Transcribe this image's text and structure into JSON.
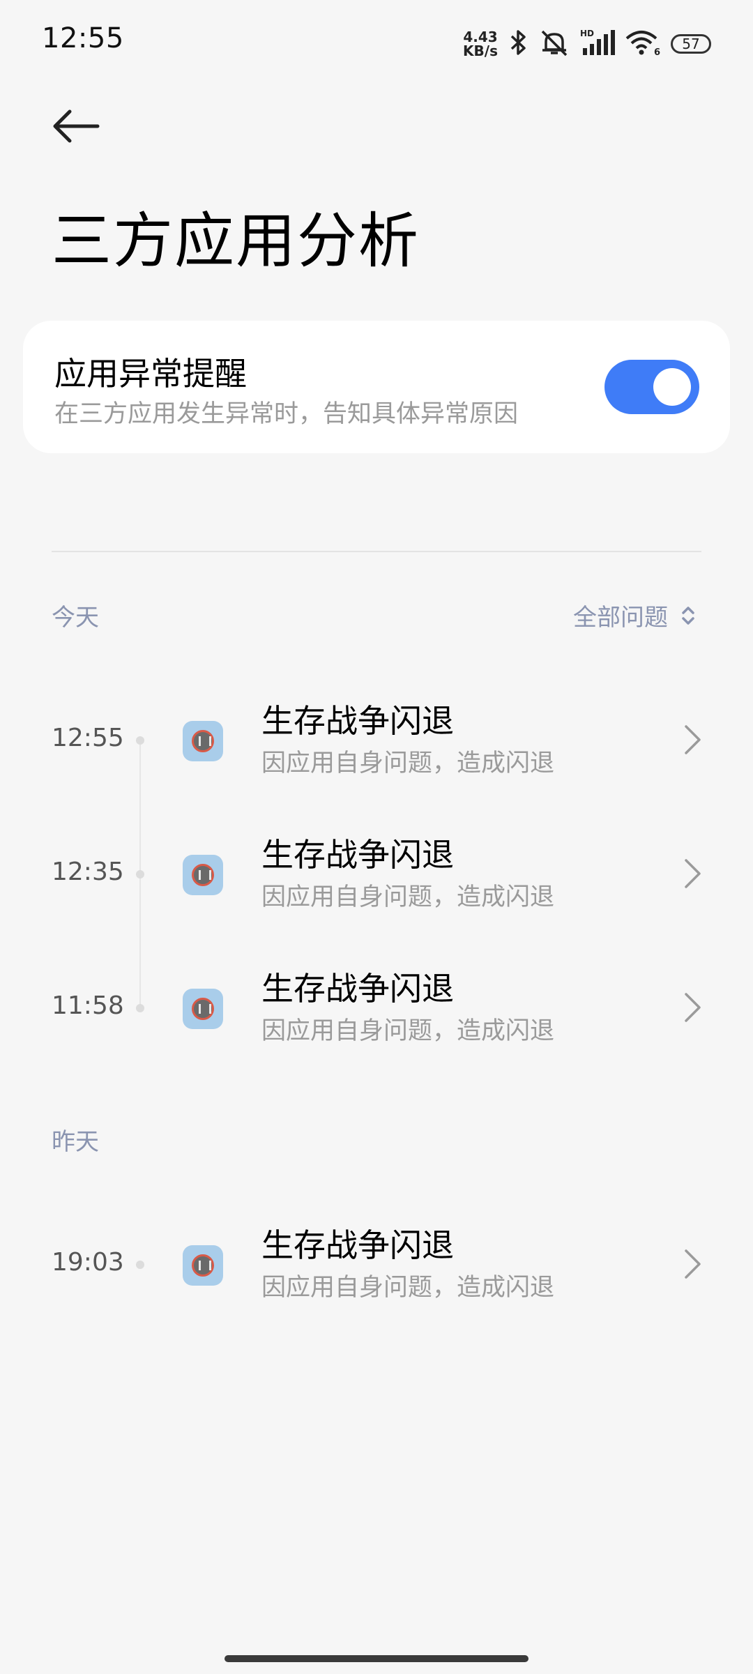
{
  "status_bar": {
    "time": "12:55",
    "net_speed_value": "4.43",
    "net_speed_unit": "KB/s",
    "signal_label": "HD",
    "wifi_label": "6",
    "battery": "57"
  },
  "header": {
    "title": "三方应用分析"
  },
  "settings_card": {
    "title": "应用异常提醒",
    "subtitle": "在三方应用发生异常时，告知具体异常原因",
    "toggle_on": true
  },
  "sections": {
    "today_label": "今天",
    "filter_label": "全部问题",
    "yesterday_label": "昨天"
  },
  "today_items": [
    {
      "time": "12:55",
      "title": "生存战争闪退",
      "subtitle": "因应用自身问题，造成闪退"
    },
    {
      "time": "12:35",
      "title": "生存战争闪退",
      "subtitle": "因应用自身问题，造成闪退"
    },
    {
      "time": "11:58",
      "title": "生存战争闪退",
      "subtitle": "因应用自身问题，造成闪退"
    }
  ],
  "yesterday_items": [
    {
      "time": "19:03",
      "title": "生存战争闪退",
      "subtitle": "因应用自身问题，造成闪退"
    }
  ],
  "colors": {
    "accent": "#3f7cf7",
    "section_label": "#8a94b0",
    "background": "#f6f6f6"
  }
}
